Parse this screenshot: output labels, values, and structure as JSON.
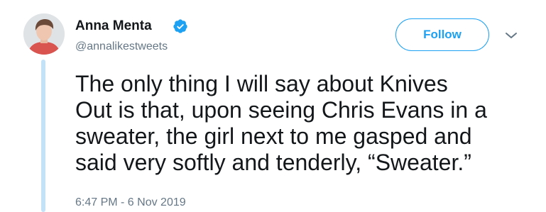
{
  "author": {
    "display_name": "Anna Menta",
    "handle": "@annalikestweets",
    "verified": true,
    "verified_icon": "verified-badge-icon",
    "avatar_icon": "avatar-photo"
  },
  "actions": {
    "follow_label": "Follow",
    "more_icon": "chevron-down-icon"
  },
  "tweet": {
    "lines": [
      "The only thing I will say about Knives",
      "Out is that, upon seeing Chris Evans in a",
      "sweater, the girl next to me gasped and",
      "said very softly and tenderly, “Sweater.”"
    ],
    "timestamp": "6:47 PM - 6 Nov 2019"
  },
  "colors": {
    "accent": "#1da1f2",
    "text": "#14171a",
    "secondary_text": "#657786",
    "thread_line": "#c4e2f7"
  }
}
